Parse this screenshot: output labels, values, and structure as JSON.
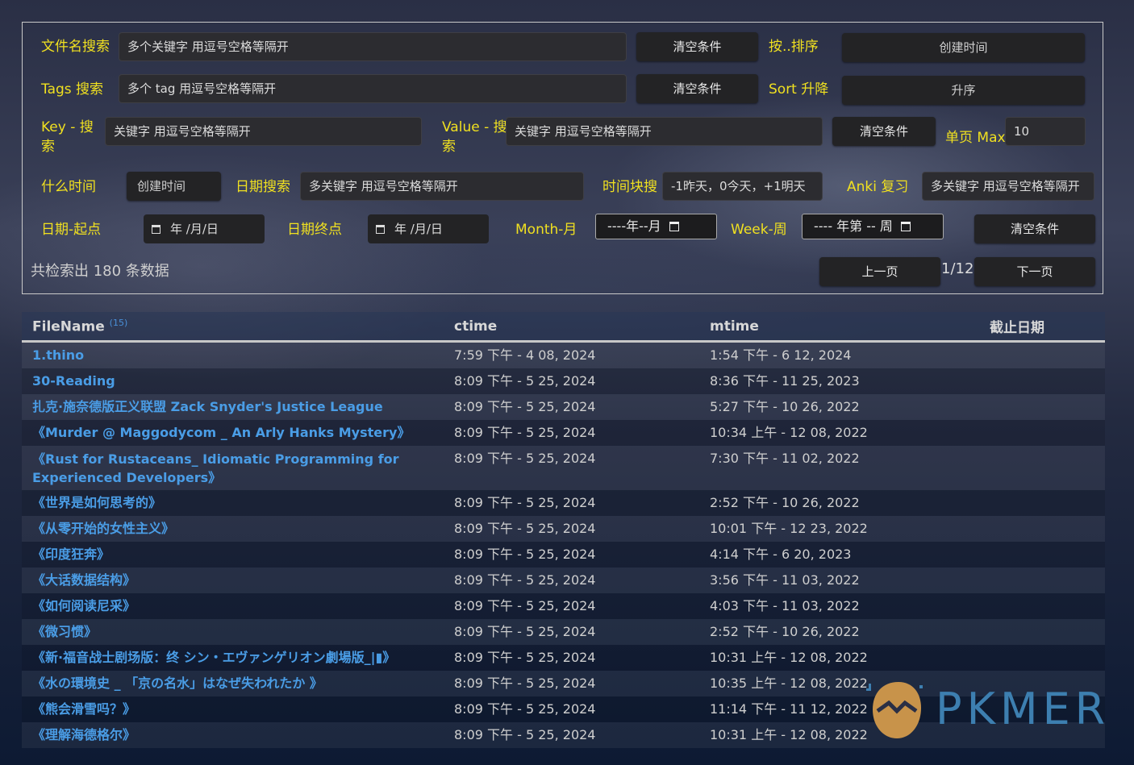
{
  "filters": {
    "filename_label": "文件名搜索",
    "filename_placeholder": "多个关键字 用逗号空格等隔开",
    "tags_label": "Tags 搜索",
    "tags_placeholder": "多个 tag 用逗号空格等隔开",
    "key_label_1": "Key - 搜",
    "key_label_2": "索",
    "key_placeholder": "关键字 用逗号空格等隔开",
    "value_label_1": "Value - 搜",
    "value_label_2": "索",
    "value_placeholder": "关键字 用逗号空格等隔开",
    "clear_label": "清空条件",
    "sort_by_label": "按..排序",
    "sort_by_value": "创建时间",
    "sort_order_label": "Sort 升降",
    "sort_order_value": "升序",
    "page_max_label": "单页 Max",
    "page_max_value": "10",
    "when_label": "什么时间",
    "when_value": "创建时间",
    "date_search_label": "日期搜索",
    "date_search_placeholder": "多关键字 用逗号空格等隔开",
    "time_block_label": "时间块搜",
    "time_block_placeholder": "-1昨天，0今天，+1明天",
    "anki_label": "Anki 复习",
    "anki_placeholder": "多关键字 用逗号空格等隔开",
    "date_start_label": "日期-起点",
    "date_start_value": "年 /月/日",
    "date_end_label": "日期终点",
    "date_end_value": "年 /月/日",
    "month_label": "Month-月",
    "month_value": "----年--月",
    "week_label": "Week-周",
    "week_value": "---- 年第 -- 周",
    "clear_label_2": "清空条件"
  },
  "summary": {
    "count_text": "共检索出 180 条数据",
    "prev_label": "上一页",
    "page_text": "1/12",
    "next_label": "下一页"
  },
  "table": {
    "headers": [
      "FileName",
      "ctime",
      "mtime",
      "截止日期"
    ],
    "filename_count": "(15)",
    "rows": [
      {
        "name": "1.thino",
        "ctime": "7:59 下午 - 4 08, 2024",
        "mtime": "1:54 下午 - 6 12, 2024"
      },
      {
        "name": "30-Reading",
        "ctime": "8:09 下午 - 5 25, 2024",
        "mtime": "8:36 下午 - 11 25, 2023"
      },
      {
        "name": "扎克·施奈德版正义联盟 Zack Snyder's Justice League",
        "ctime": "8:09 下午 - 5 25, 2024",
        "mtime": "5:27 下午 - 10 26, 2022"
      },
      {
        "name": "《Murder @ Maggodycom _ An Arly Hanks Mystery》",
        "ctime": "8:09 下午 - 5 25, 2024",
        "mtime": "10:34 上午 - 12 08, 2022"
      },
      {
        "name": "《Rust for Rustaceans_ Idiomatic Programming for Experienced Developers》",
        "ctime": "8:09 下午 - 5 25, 2024",
        "mtime": "7:30 下午 - 11 02, 2022"
      },
      {
        "name": "《世界是如何思考的》",
        "ctime": "8:09 下午 - 5 25, 2024",
        "mtime": "2:52 下午 - 10 26, 2022"
      },
      {
        "name": "《从零开始的女性主义》",
        "ctime": "8:09 下午 - 5 25, 2024",
        "mtime": "10:01 下午 - 12 23, 2022"
      },
      {
        "name": "《印度狂奔》",
        "ctime": "8:09 下午 - 5 25, 2024",
        "mtime": "4:14 下午 - 6 20, 2023"
      },
      {
        "name": "《大话数据结构》",
        "ctime": "8:09 下午 - 5 25, 2024",
        "mtime": "3:56 下午 - 11 03, 2022"
      },
      {
        "name": "《如何阅读尼采》",
        "ctime": "8:09 下午 - 5 25, 2024",
        "mtime": "4:03 下午 - 11 03, 2022"
      },
      {
        "name": "《微习惯》",
        "ctime": "8:09 下午 - 5 25, 2024",
        "mtime": "2:52 下午 - 10 26, 2022"
      },
      {
        "name": "《新·福音战士剧场版：终 シン・エヴァンゲリオン劇場版_|▮》",
        "ctime": "8:09 下午 - 5 25, 2024",
        "mtime": "10:31 上午 - 12 08, 2022"
      },
      {
        "name": "《水の環境史 _ 「京の名水」はなぜ失われたか 》",
        "ctime": "8:09 下午 - 5 25, 2024",
        "mtime": "10:35 上午 - 12 08, 2022"
      },
      {
        "name": "《熊会滑雪吗？》",
        "ctime": "8:09 下午 - 5 25, 2024",
        "mtime": "11:14 下午 - 11 12, 2022"
      },
      {
        "name": "《理解海德格尔》",
        "ctime": "8:09 下午 - 5 25, 2024",
        "mtime": "10:31 上午 - 12 08, 2022"
      }
    ]
  },
  "watermark": {
    "text": "PKMER"
  }
}
